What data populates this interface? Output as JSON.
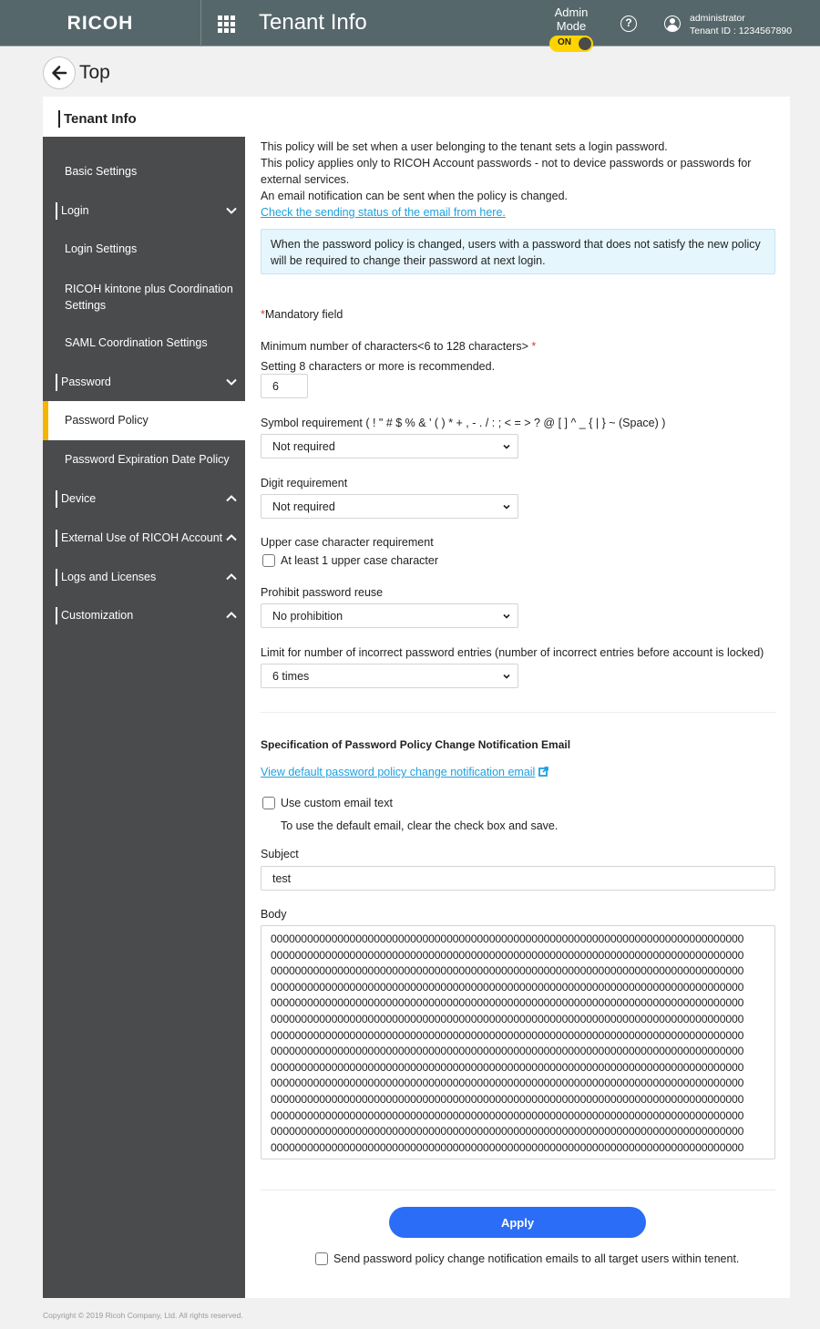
{
  "header": {
    "logo": "RICOH",
    "app_title": "Tenant Info",
    "admin_mode_label": "Admin Mode",
    "admin_mode_state": "ON",
    "user_name": "administrator",
    "tenant_id": "Tenant ID : 1234567890",
    "icons": {
      "apps": "grid-icon",
      "help": "question-circle-icon",
      "user": "user-circle-icon"
    }
  },
  "nav": {
    "back_label": "Top",
    "card_title": "Tenant Info"
  },
  "sidebar": {
    "items": [
      {
        "type": "sub",
        "label": "Basic Settings"
      },
      {
        "type": "group",
        "label": "Login",
        "state": "expanded"
      },
      {
        "type": "sub",
        "label": "Login Settings"
      },
      {
        "type": "sub",
        "label": "RICOH kintone plus Coordination Settings"
      },
      {
        "type": "sub",
        "label": "SAML Coordination Settings"
      },
      {
        "type": "group",
        "label": "Password",
        "state": "expanded"
      },
      {
        "type": "sub",
        "label": "Password Policy",
        "active": true
      },
      {
        "type": "sub",
        "label": "Password Expiration Date Policy"
      },
      {
        "type": "group",
        "label": "Device",
        "state": "collapsed"
      },
      {
        "type": "group",
        "label": "External Use of RICOH Account",
        "state": "collapsed"
      },
      {
        "type": "group",
        "label": "Logs and Licenses",
        "state": "collapsed"
      },
      {
        "type": "group",
        "label": "Customization",
        "state": "collapsed"
      }
    ]
  },
  "intro": {
    "line1": "This policy will be set when a user belonging to the tenant sets a login password.",
    "line2": "This policy applies only to RICOH Account passwords - not to device passwords or passwords for external services.",
    "line3": "An email notification can be sent when the policy is changed.",
    "status_link": "Check the sending status of the email from here.",
    "info_box": "When the password policy is changed, users with a password that does not satisfy the new policy will be required to change their password at next login."
  },
  "form": {
    "mandatory_asterisk": "*",
    "mandatory_note": "Mandatory field",
    "min_chars_label": "Minimum number of characters<6 to 128 characters>",
    "min_chars_hint": "Setting 8 characters or more is recommended.",
    "min_chars_value": "6",
    "symbol_label": "Symbol requirement ( ! \" # $ % & ' ( ) * + , - . / : ; < = > ? @ [ ] ^ _ { | } ~ (Space) )",
    "symbol_value": "Not required",
    "digit_label": "Digit requirement",
    "digit_value": "Not required",
    "uppercase_label": "Upper case character requirement",
    "uppercase_checkbox_label": "At least 1 upper case character",
    "uppercase_checked": false,
    "reuse_label": "Prohibit password reuse",
    "reuse_value": "No prohibition",
    "lockout_label": "Limit for number of incorrect password entries (number of incorrect entries before account is locked)",
    "lockout_value": "6 times"
  },
  "email": {
    "section_title": "Specification of Password Policy Change Notification Email",
    "view_default_link": "View default password policy change notification email",
    "custom_text_label": "Use custom email text",
    "custom_text_checked": false,
    "custom_text_hint": "To use the default email, clear the check box and save.",
    "subject_label": "Subject",
    "subject_value": "test",
    "body_label": "Body",
    "body_line": "000000000000000000000000000000000000000000000000000000000000000000000000000000",
    "body_visible_lines": 14
  },
  "actions": {
    "apply_label": "Apply",
    "send_all_label": "Send password policy change notification emails to all target users within tenent.",
    "send_all_checked": false
  },
  "colors": {
    "header_bg": "#56676b",
    "sidebar_bg": "#4a4b4d",
    "active_accent": "#f5b400",
    "toggle_on": "#ffd400",
    "link": "#1ea0e0",
    "primary_button": "#2b6df6",
    "info_bg": "#e6f6fd",
    "required": "#e0383e"
  },
  "footer": {
    "copyright": "Copyright © 2019 Ricoh Company, Ltd. All rights reserved."
  }
}
